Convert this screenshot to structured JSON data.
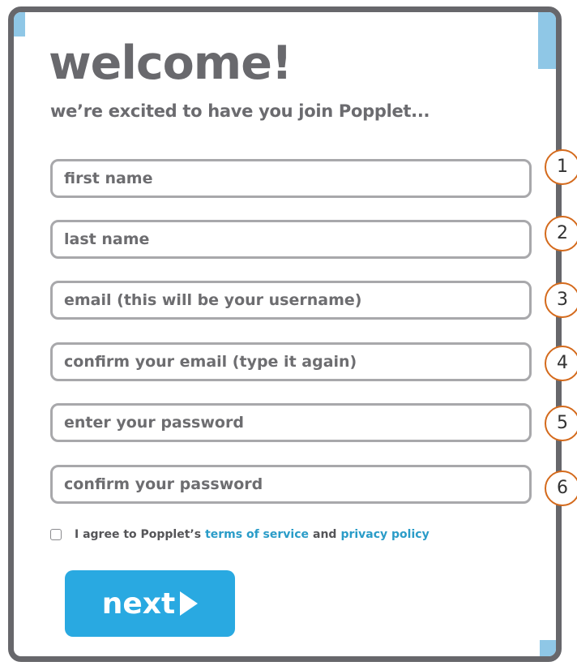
{
  "header": {
    "title": "welcome!",
    "subtitle": "we’re excited to have you join Popplet..."
  },
  "form": {
    "fields": [
      {
        "placeholder": "first name",
        "number": "1"
      },
      {
        "placeholder": "last name",
        "number": "2"
      },
      {
        "placeholder": "email (this will be your username)",
        "number": "3"
      },
      {
        "placeholder": "confirm your email (type it again)",
        "number": "4"
      },
      {
        "placeholder": "enter your password",
        "number": "5"
      },
      {
        "placeholder": "confirm your password",
        "number": "6"
      }
    ],
    "agree": {
      "prefix": "I agree to Popplet’s",
      "terms_link": "terms of service",
      "and": "and",
      "privacy_link": "privacy policy",
      "checked": false
    },
    "next_label": "next"
  },
  "colors": {
    "accent": "#29a9e1",
    "link": "#2a9cc8",
    "badge_border": "#d46a1c",
    "text_gray": "#69696d"
  }
}
